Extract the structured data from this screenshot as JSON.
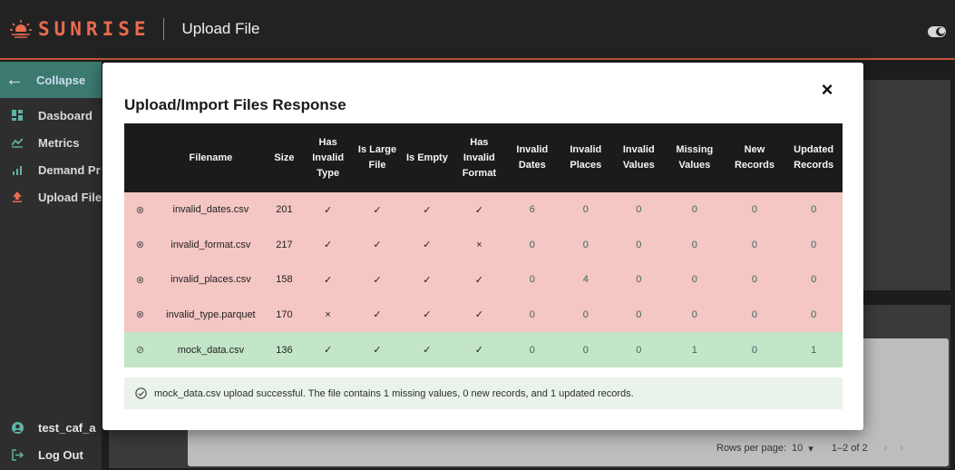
{
  "header": {
    "brand": "SUNRISE",
    "page_title": "Upload File",
    "icons": {
      "logo": "sunrise-logo-icon",
      "theme": "theme-toggle-icon"
    },
    "accent": "#e96b4f"
  },
  "sidebar": {
    "collapse_label": "Collapse",
    "items": [
      {
        "label": "Dasboard",
        "icon": "dashboard-icon"
      },
      {
        "label": "Metrics",
        "icon": "metrics-icon"
      },
      {
        "label": "Demand Pr",
        "icon": "bar-chart-icon"
      },
      {
        "label": "Upload File",
        "icon": "upload-icon"
      }
    ],
    "bottom": [
      {
        "label": "test_caf_a",
        "icon": "user-icon"
      },
      {
        "label": "Log Out",
        "icon": "logout-icon"
      }
    ],
    "active_color": "#3c7a6f"
  },
  "background": {
    "pagination": {
      "rows_label": "Rows per page:",
      "rows_value": "10",
      "range": "1–2 of 2"
    }
  },
  "modal": {
    "title": "Upload/Import Files Response",
    "close": "×",
    "columns": [
      "",
      "Filename",
      "Size",
      "Has Invalid Type",
      "Is Large File",
      "Is Empty",
      "Has Invalid Format",
      "Invalid Dates",
      "Invalid Places",
      "Invalid Values",
      "Missing Values",
      "New Records",
      "Updated Records"
    ],
    "rows": [
      {
        "status": "error",
        "icon": "⊗",
        "filename": "invalid_dates.csv",
        "size": "201",
        "invalid_type": "✓",
        "large": "✓",
        "empty": "✓",
        "invalid_format": "✓",
        "dates": "6",
        "places": "0",
        "values": "0",
        "missing": "0",
        "new": "0",
        "updated": "0"
      },
      {
        "status": "error",
        "icon": "⊗",
        "filename": "invalid_format.csv",
        "size": "217",
        "invalid_type": "✓",
        "large": "✓",
        "empty": "✓",
        "invalid_format": "×",
        "dates": "0",
        "places": "0",
        "values": "0",
        "missing": "0",
        "new": "0",
        "updated": "0"
      },
      {
        "status": "error",
        "icon": "⊗",
        "filename": "invalid_places.csv",
        "size": "158",
        "invalid_type": "✓",
        "large": "✓",
        "empty": "✓",
        "invalid_format": "✓",
        "dates": "0",
        "places": "4",
        "values": "0",
        "missing": "0",
        "new": "0",
        "updated": "0"
      },
      {
        "status": "error",
        "icon": "⊗",
        "filename": "invalid_type.parquet",
        "size": "170",
        "invalid_type": "×",
        "large": "✓",
        "empty": "✓",
        "invalid_format": "✓",
        "dates": "0",
        "places": "0",
        "values": "0",
        "missing": "0",
        "new": "0",
        "updated": "0"
      },
      {
        "status": "ok",
        "icon": "⊘",
        "filename": "mock_data.csv",
        "size": "136",
        "invalid_type": "✓",
        "large": "✓",
        "empty": "✓",
        "invalid_format": "✓",
        "dates": "0",
        "places": "0",
        "values": "0",
        "missing": "1",
        "new": "0",
        "updated": "1"
      }
    ],
    "success_message": "mock_data.csv upload successful. The file contains 1 missing values, 0 new records, and 1 updated records.",
    "colors": {
      "error_row": "#f4c6c4",
      "ok_row": "#c3e5c8",
      "header": "#1b1b1b"
    }
  }
}
